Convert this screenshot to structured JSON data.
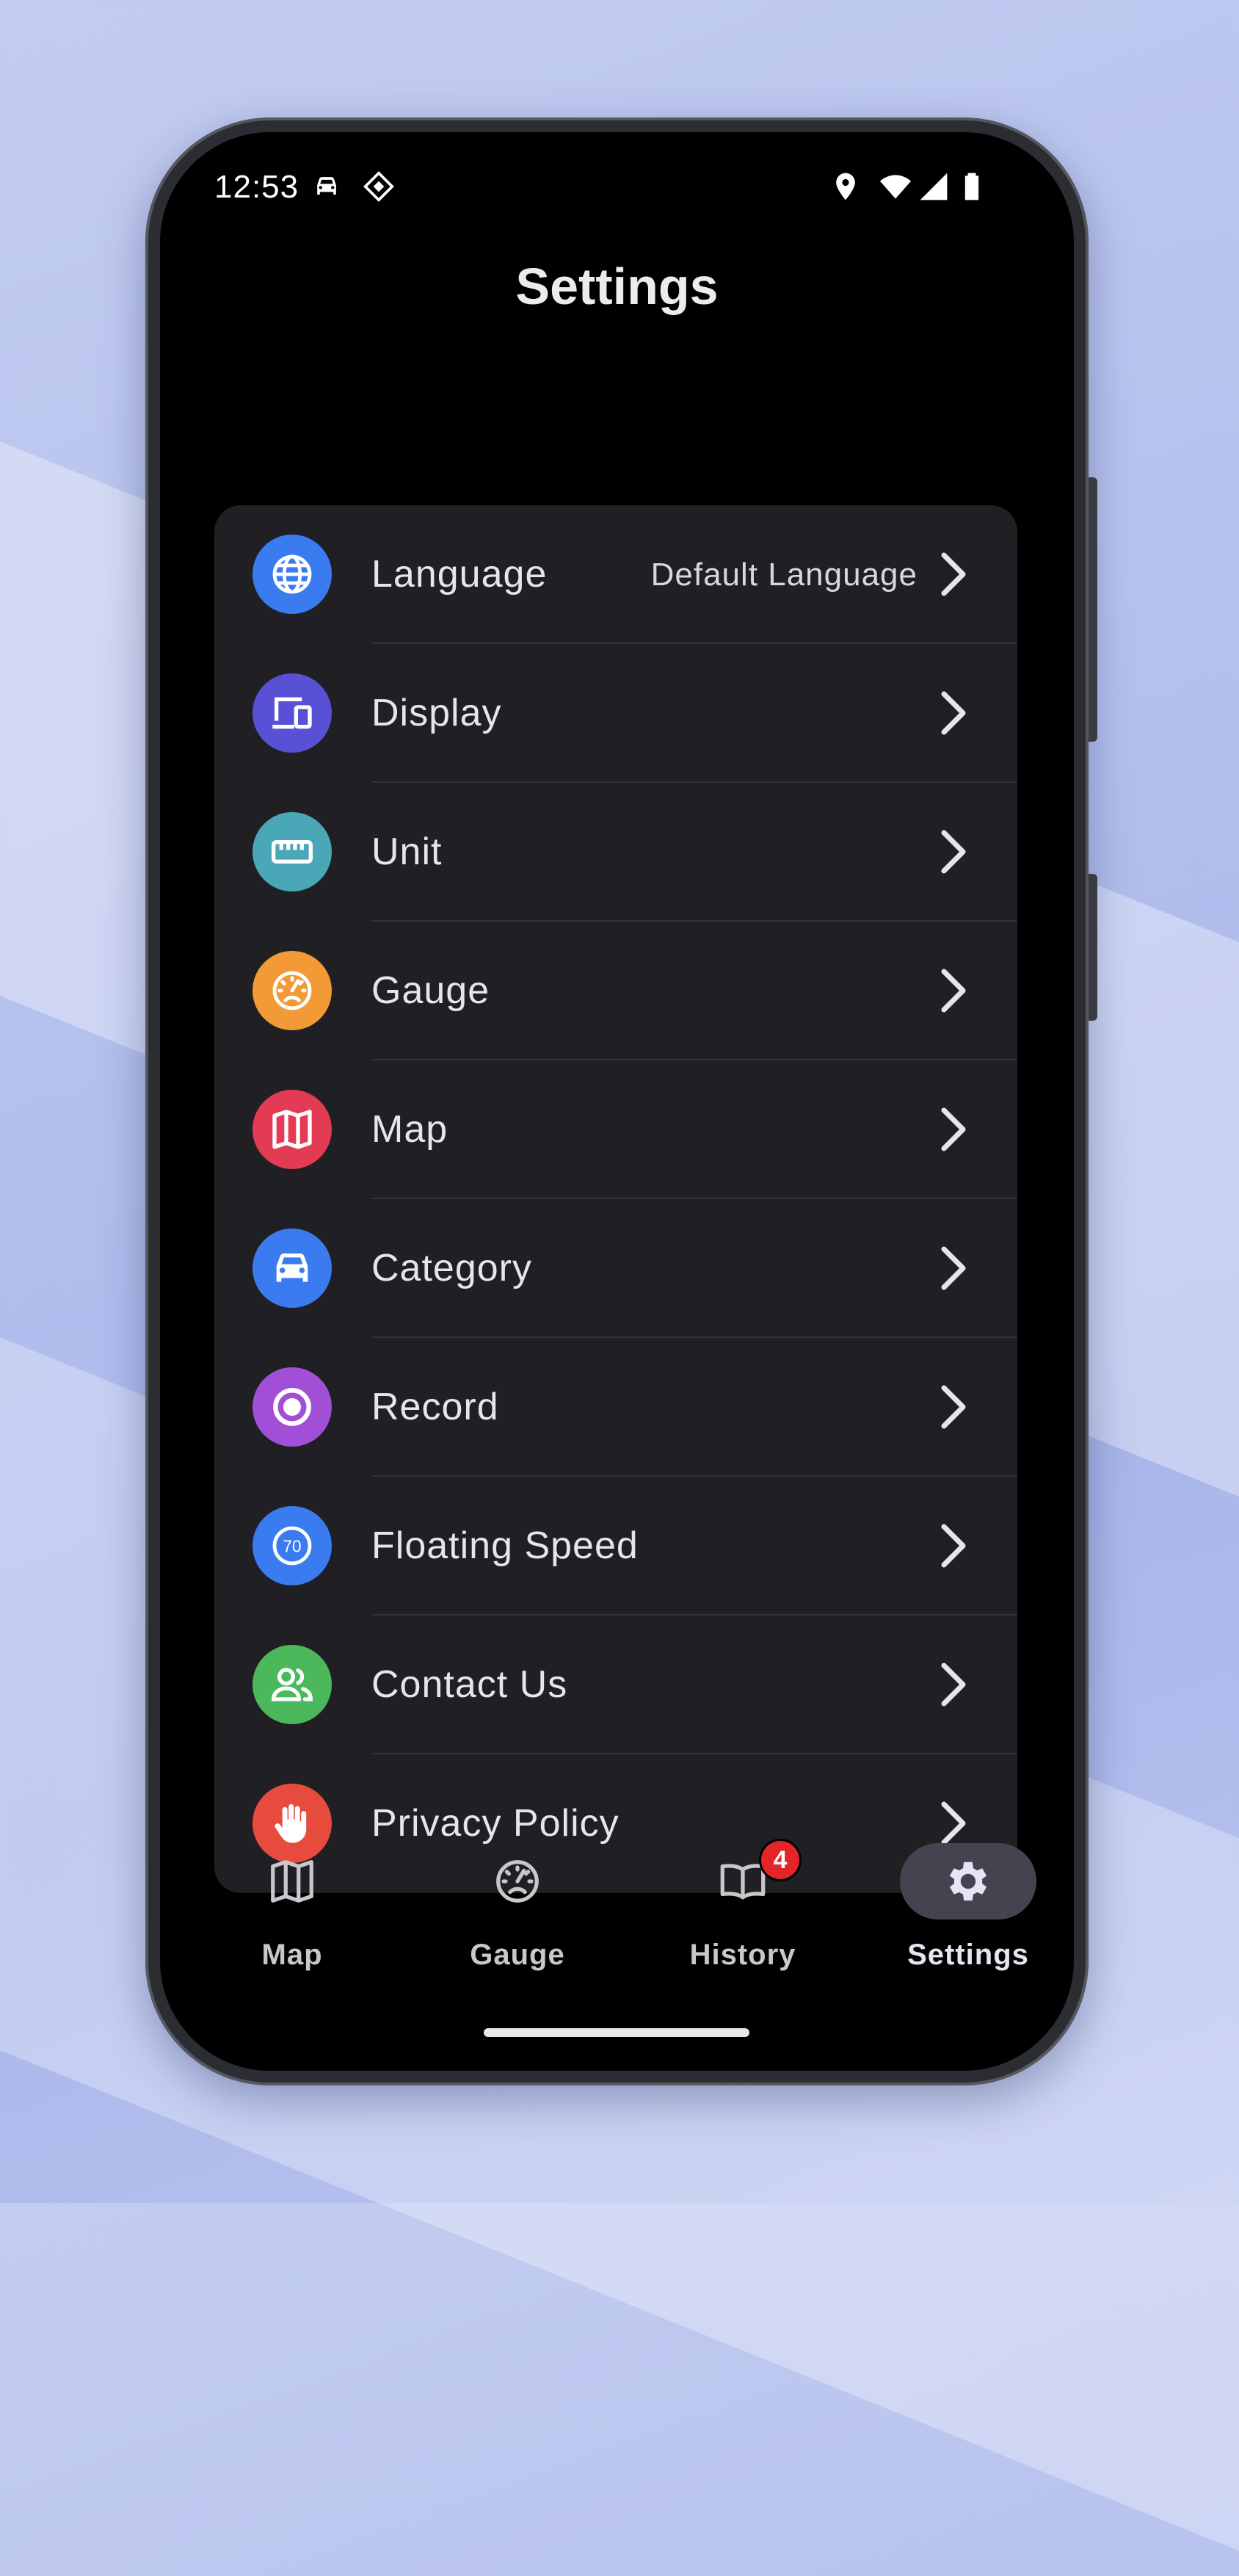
{
  "status_bar": {
    "time": "12:53",
    "icons": [
      "car-icon",
      "nfc-icon",
      "location-icon",
      "wifi-icon",
      "signal-icon",
      "battery-icon"
    ]
  },
  "page": {
    "title": "Settings"
  },
  "settings": {
    "items": [
      {
        "label": "Language",
        "value": "Default Language",
        "icon": "globe-icon",
        "color": "#3a7bf0"
      },
      {
        "label": "Display",
        "icon": "devices-icon",
        "color": "#5851d6"
      },
      {
        "label": "Unit",
        "icon": "ruler-icon",
        "color": "#4aa7b7"
      },
      {
        "label": "Gauge",
        "icon": "speedometer-icon",
        "color": "#f29a36"
      },
      {
        "label": "Map",
        "icon": "map-icon",
        "color": "#e23b53"
      },
      {
        "label": "Category",
        "icon": "car-icon",
        "color": "#3a7bf0"
      },
      {
        "label": "Record",
        "icon": "record-icon",
        "color": "#a24fd8"
      },
      {
        "label": "Floating Speed",
        "icon": "speed-limit-icon",
        "icon_text": "70",
        "color": "#3a7bf0"
      },
      {
        "label": "Contact Us",
        "icon": "people-icon",
        "color": "#4ab85b"
      },
      {
        "label": "Privacy Policy",
        "icon": "hand-icon",
        "color": "#e64b3e"
      }
    ]
  },
  "nav": {
    "items": [
      {
        "label": "Map",
        "icon": "map-icon",
        "active": false
      },
      {
        "label": "Gauge",
        "icon": "speedometer-icon",
        "active": false
      },
      {
        "label": "History",
        "icon": "book-icon",
        "badge": "4",
        "active": false
      },
      {
        "label": "Settings",
        "icon": "gear-icon",
        "active": true
      }
    ]
  }
}
